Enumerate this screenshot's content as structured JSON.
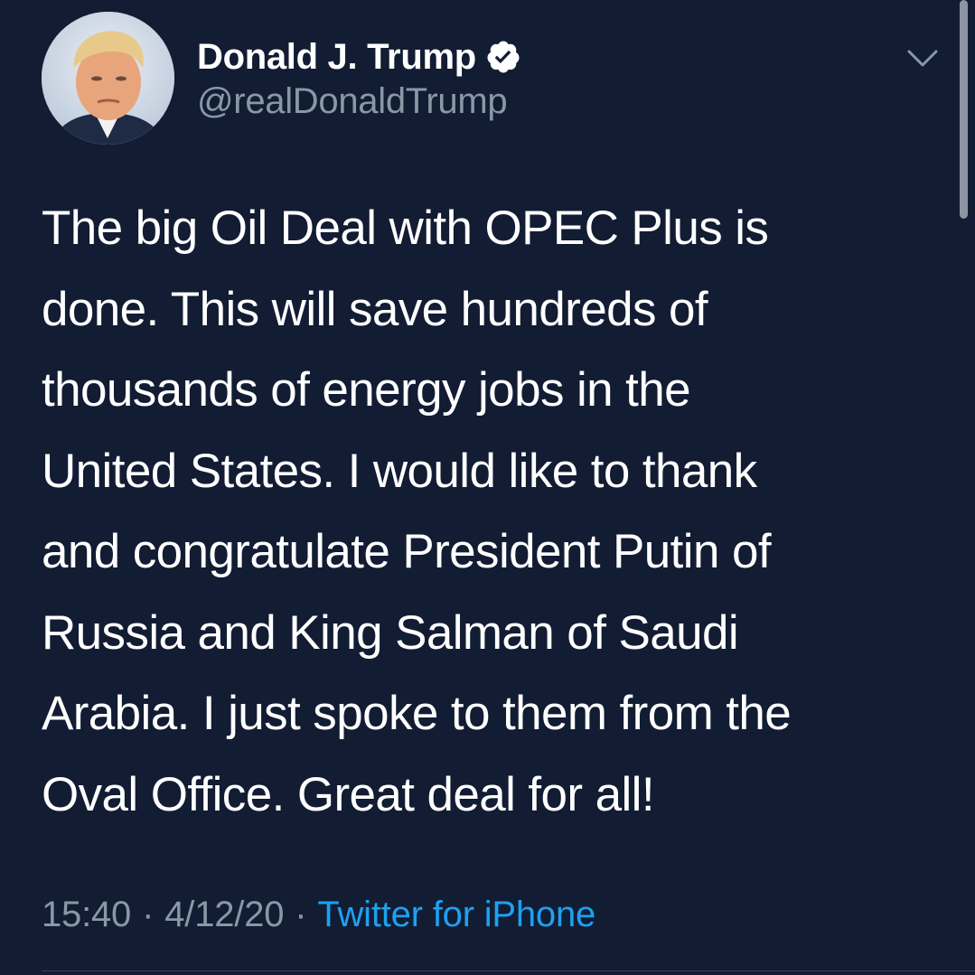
{
  "user": {
    "display_name": "Donald J. Trump",
    "handle": "@realDonaldTrump",
    "verified": true
  },
  "tweet": {
    "text_lines": [
      "The big Oil Deal with OPEC Plus is",
      "done. This will save hundreds of",
      "thousands of energy jobs in the",
      "United States. I would like to thank",
      "and congratulate President Putin of",
      "Russia and King Salman of Saudi",
      "Arabia. I just spoke to them from the",
      "Oval Office. Great deal for all!"
    ],
    "time": "15:40",
    "separator": "·",
    "date": "4/12/20",
    "source": "Twitter for iPhone"
  },
  "icons": {
    "verified": "verified-badge-icon",
    "more": "chevron-down-icon"
  },
  "colors": {
    "background": "#121c33",
    "text": "#ffffff",
    "secondary_text": "#8899a6",
    "link": "#1da1f2"
  }
}
